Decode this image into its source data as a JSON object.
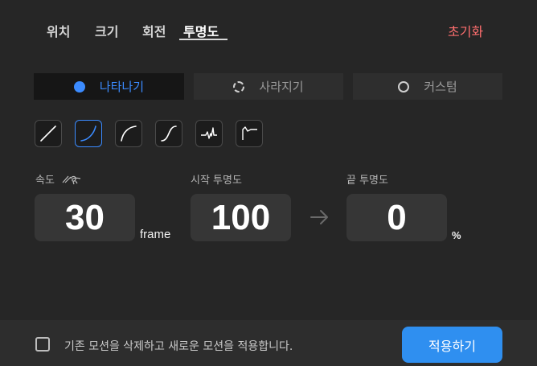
{
  "tabs": [
    {
      "label": "위치"
    },
    {
      "label": "크기"
    },
    {
      "label": "회전"
    },
    {
      "label": "투명도"
    }
  ],
  "active_tab": "투명도",
  "reset_label": "초기화",
  "modes": [
    {
      "label": "나타나기",
      "icon": "filled-dot-icon",
      "selected": true
    },
    {
      "label": "사라지기",
      "icon": "dashed-circle-icon",
      "selected": false
    },
    {
      "label": "커스텀",
      "icon": "ring-icon",
      "selected": false
    }
  ],
  "easing_curves": [
    {
      "icon": "linear-curve-icon",
      "selected": false
    },
    {
      "icon": "ease-in-curve-icon",
      "selected": true
    },
    {
      "icon": "ease-out-curve-icon",
      "selected": false
    },
    {
      "icon": "ease-in-out-curve-icon",
      "selected": false
    },
    {
      "icon": "wiggle-curve-icon",
      "selected": false
    },
    {
      "icon": "overshoot-curve-icon",
      "selected": false
    }
  ],
  "speed": {
    "label": "속도",
    "value": "30",
    "unit": "frame"
  },
  "start_opacity": {
    "label": "시작 투명도",
    "value": "100"
  },
  "end_opacity": {
    "label": "끝 투명도",
    "value": "0",
    "unit": "%"
  },
  "footer": {
    "checkbox_label": "기존 모션을 삭제하고 새로운 모션을 적용합니다.",
    "checked": false,
    "apply_label": "적용하기"
  },
  "colors": {
    "accent": "#2f8ff0",
    "selected_text": "#3b8bff",
    "reset": "#ff6f6f",
    "background": "#262626"
  }
}
